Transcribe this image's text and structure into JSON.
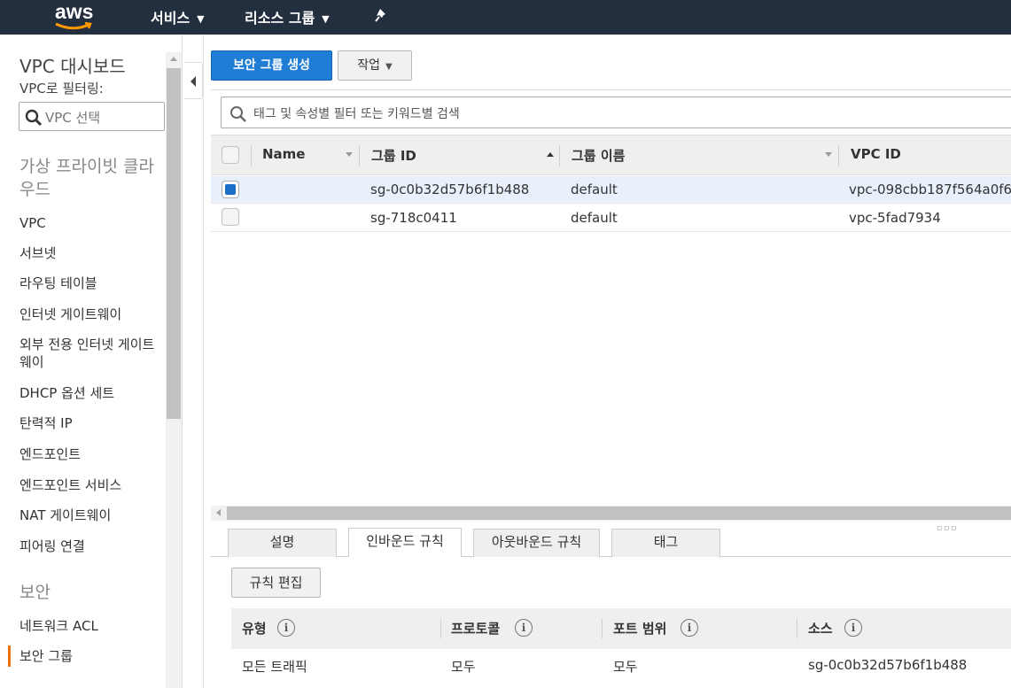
{
  "topbar": {
    "logo": "aws",
    "services": "서비스",
    "resource_groups": "리소스 그룹"
  },
  "sidebar": {
    "title": "VPC 대시보드",
    "filter_label": "VPC로 필터링:",
    "filter_placeholder": "VPC 선택",
    "section_cloud": "가상 프라이빗 클라우드",
    "items": [
      "VPC",
      "서브넷",
      "라우팅 테이블",
      "인터넷 게이트웨이",
      "외부 전용 인터넷 게이트웨이",
      "DHCP 옵션 세트",
      "탄력적 IP",
      "엔드포인트",
      "엔드포인트 서비스",
      "NAT 게이트웨이",
      "피어링 연결"
    ],
    "section_security": "보안",
    "security_items": [
      "네트워크 ACL",
      "보안 그룹"
    ],
    "accent_color": "#ec7211"
  },
  "toolbar": {
    "create_label": "보안 그룹 생성",
    "actions_label": "작업",
    "primary_color": "#1f7dd5"
  },
  "search": {
    "placeholder": "태그 및 속성별 필터 또는 키워드별 검색"
  },
  "table": {
    "columns": [
      "Name",
      "그룹 ID",
      "그룹 이름",
      "VPC ID"
    ],
    "rows": [
      {
        "name": "",
        "group_id": "sg-0c0b32d57b6f1b488",
        "group_name": "default",
        "vpc_id": "vpc-098cbb187f564a0f6",
        "selected": true
      },
      {
        "name": "",
        "group_id": "sg-718c0411",
        "group_name": "default",
        "vpc_id": "vpc-5fad7934",
        "selected": false
      }
    ]
  },
  "detail": {
    "tabs": [
      "설명",
      "인바운드 규칙",
      "아웃바운드 규칙",
      "태그"
    ],
    "active_tab": "인바운드 규칙",
    "edit_label": "규칙 편집",
    "rule_columns": [
      "유형",
      "프로토콜",
      "포트 범위",
      "소스"
    ],
    "rules": [
      {
        "type": "모든 트래픽",
        "protocol": "모두",
        "port_range": "모두",
        "source": "sg-0c0b32d57b6f1b488"
      }
    ]
  }
}
